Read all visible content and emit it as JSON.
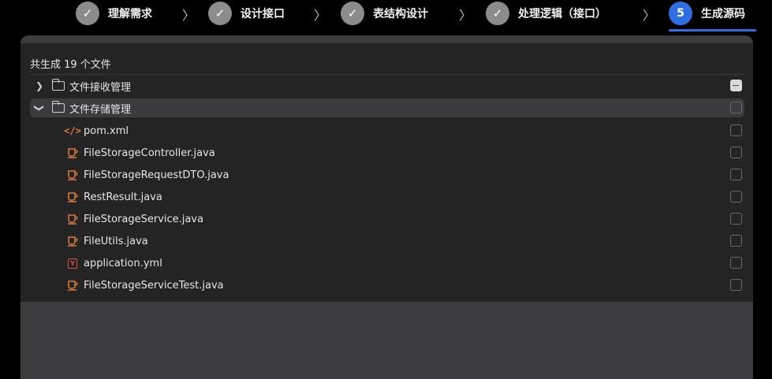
{
  "steps": [
    {
      "label": "理解需求",
      "state": "done",
      "symbol": "✓"
    },
    {
      "label": "设计接口",
      "state": "done",
      "symbol": "✓"
    },
    {
      "label": "表结构设计",
      "state": "done",
      "symbol": "✓"
    },
    {
      "label": "处理逻辑（接口）",
      "state": "done",
      "symbol": "✓"
    },
    {
      "label": "生成源码",
      "state": "active",
      "symbol": "5"
    }
  ],
  "icons": {
    "step_done": "check-icon",
    "step_arrow": "chevron-right-icon",
    "folder": "folder-icon",
    "java": "coffee-cup-icon",
    "xml": "code-icon",
    "yml": "yaml-icon"
  },
  "colors": {
    "accent": "#2f6ee0",
    "java_icon": "#e07b3d",
    "yml_icon": "#d2534a"
  },
  "summary": "共生成 19 个文件",
  "folders": [
    {
      "name": "文件接收管理",
      "expanded": false,
      "checkbox": "partial"
    },
    {
      "name": "文件存储管理",
      "expanded": true,
      "checkbox": "unchecked"
    }
  ],
  "files": [
    {
      "name": "pom.xml",
      "type": "xml"
    },
    {
      "name": "FileStorageController.java",
      "type": "java"
    },
    {
      "name": "FileStorageRequestDTO.java",
      "type": "java"
    },
    {
      "name": "RestResult.java",
      "type": "java"
    },
    {
      "name": "FileStorageService.java",
      "type": "java"
    },
    {
      "name": "FileUtils.java",
      "type": "java"
    },
    {
      "name": "application.yml",
      "type": "yml"
    },
    {
      "name": "FileStorageServiceTest.java",
      "type": "java"
    }
  ]
}
